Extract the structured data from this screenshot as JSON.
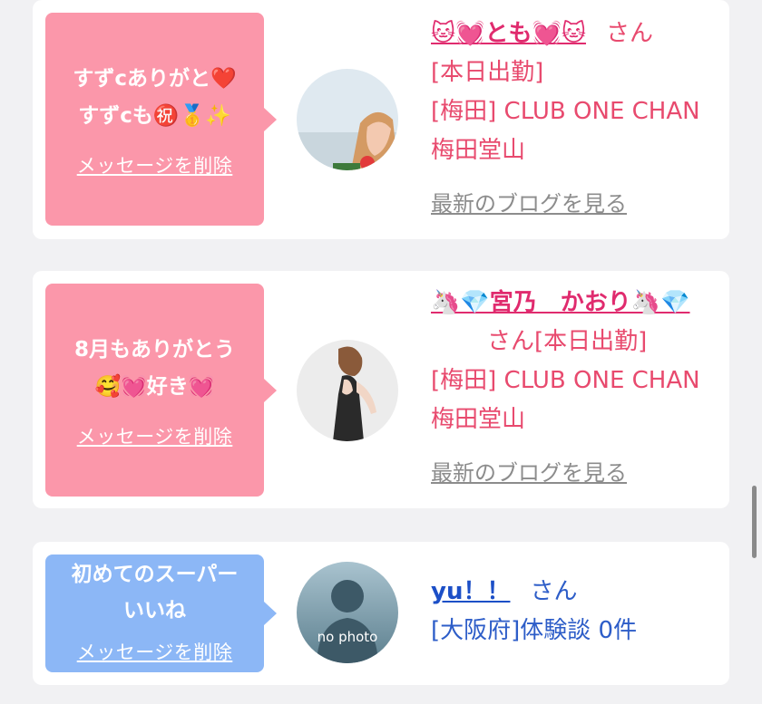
{
  "cards": [
    {
      "message": "すずcありがと❤️\nすずcも㊗️🥇✨",
      "delete_label": "メッセージを削除",
      "name": "🐱💓とも💓🐱",
      "suffix": "さん",
      "line2": "[本日出勤]",
      "location": "[梅田] CLUB ONE CHAN 梅田堂山",
      "blog_link": "最新のブログを見る",
      "avatar_icon": "photo-avatar-icon"
    },
    {
      "message": "8月もありがとう\n🥰💓好き💓",
      "delete_label": "メッセージを削除",
      "name": "🦄💎宮乃　かおり🦄💎",
      "suffix": "さん[本日出勤]",
      "location": "[梅田] CLUB ONE CHAN 梅田堂山",
      "blog_link": "最新のブログを見る",
      "avatar_icon": "photo-avatar-icon"
    },
    {
      "message": "初めてのスーパー\nいいね",
      "delete_label": "メッセージを削除",
      "name": "yu！！",
      "suffix": "さん",
      "location": "[大阪府]体験談 0件",
      "avatar_text": "no photo",
      "avatar_icon": "no-photo-avatar-icon"
    }
  ],
  "colors": {
    "pink_bubble": "#fb97aa",
    "blue_bubble": "#8cb7f6",
    "pink_text": "#e84a6e",
    "blue_text": "#2d5dc8"
  }
}
